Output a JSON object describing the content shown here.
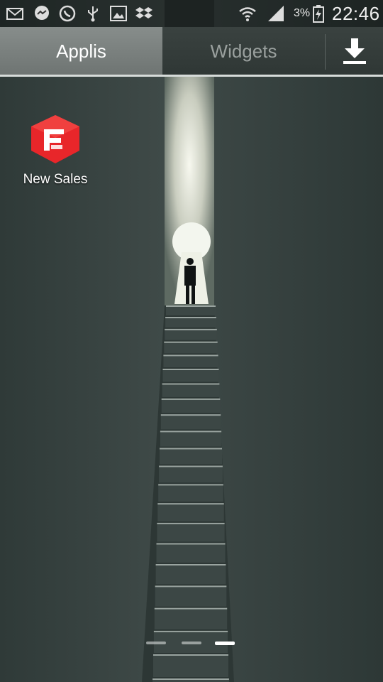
{
  "status_bar": {
    "notification_icons": [
      "mail-icon",
      "messenger-icon",
      "whatsapp-icon",
      "usb-icon",
      "gallery-icon",
      "dropbox-icon"
    ],
    "system_icons": [
      "wifi-icon",
      "signal-icon",
      "battery-icon"
    ],
    "battery_percent": "3%",
    "time": "22:46"
  },
  "tabs": {
    "active": "Applis",
    "items": [
      "Applis",
      "Widgets"
    ]
  },
  "apps": [
    {
      "label": "New Sales",
      "icon": "new-sales-app-icon",
      "color": "#e8262a"
    }
  ],
  "page_indicator": {
    "count": 3,
    "active_index": 2
  },
  "colors": {
    "active_tab": "#7d8381",
    "accent_underline": "#d7dcda",
    "app_icon_red": "#e8262a"
  }
}
